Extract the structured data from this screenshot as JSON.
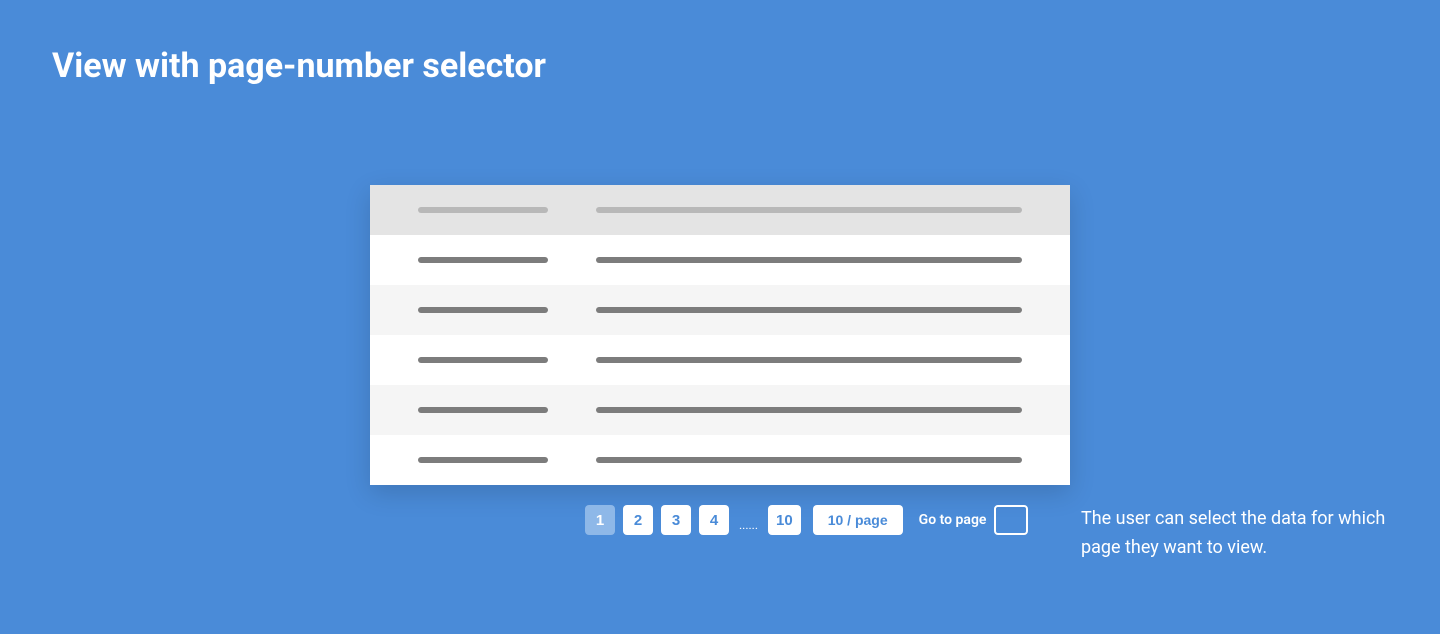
{
  "title": "View with page-number selector",
  "pagination": {
    "pages": [
      "1",
      "2",
      "3",
      "4"
    ],
    "ellipsis": "......",
    "last_page": "10",
    "active_index": 0,
    "per_page_label": "10 / page",
    "goto_label": "Go to page",
    "goto_value": ""
  },
  "description": "The user can select the data for which page they want to view."
}
